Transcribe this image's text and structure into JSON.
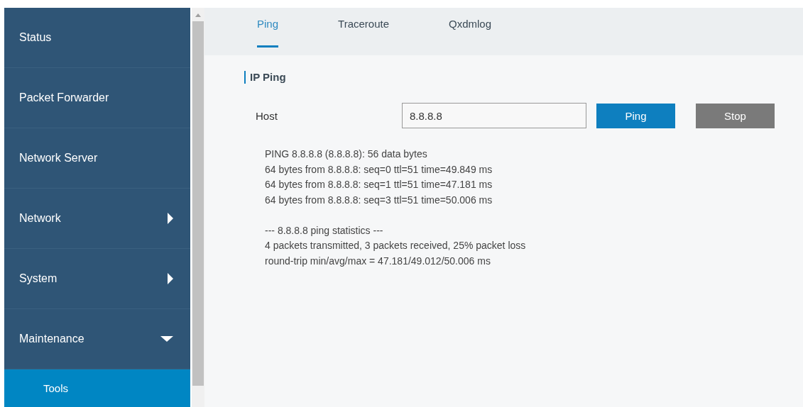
{
  "sidebar": {
    "items": [
      {
        "label": "Status",
        "kind": "link",
        "selected": false
      },
      {
        "label": "Packet Forwarder",
        "kind": "link",
        "selected": false
      },
      {
        "label": "Network Server",
        "kind": "link",
        "selected": false
      },
      {
        "label": "Network",
        "kind": "group",
        "expanded": false,
        "selected": false
      },
      {
        "label": "System",
        "kind": "group",
        "expanded": false,
        "selected": false
      },
      {
        "label": "Maintenance",
        "kind": "group",
        "expanded": true,
        "selected": false,
        "children": [
          {
            "label": "Tools",
            "selected": true
          }
        ]
      }
    ]
  },
  "tabs": [
    {
      "label": "Ping",
      "selected": true
    },
    {
      "label": "Traceroute",
      "selected": false
    },
    {
      "label": "Qxdmlog",
      "selected": false
    }
  ],
  "section": {
    "title": "IP Ping"
  },
  "host": {
    "label": "Host",
    "value": "8.8.8.8"
  },
  "buttons": [
    {
      "label": "Ping",
      "kind": "primary"
    },
    {
      "label": "Stop",
      "kind": "secondary"
    }
  ],
  "output": [
    [
      "PING 8.8.8.8 (8.8.8.8): 56 data bytes",
      "64 bytes from 8.8.8.8: seq=0 ttl=51 time=49.849 ms",
      "64 bytes from 8.8.8.8: seq=1 ttl=51 time=47.181 ms",
      "64 bytes from 8.8.8.8: seq=3 ttl=51 time=50.006 ms"
    ],
    [
      "--- 8.8.8.8 ping statistics ---",
      "4 packets transmitted, 3 packets received, 25% packet loss",
      "round-trip min/avg/max = 47.181/49.012/50.006 ms"
    ]
  ]
}
